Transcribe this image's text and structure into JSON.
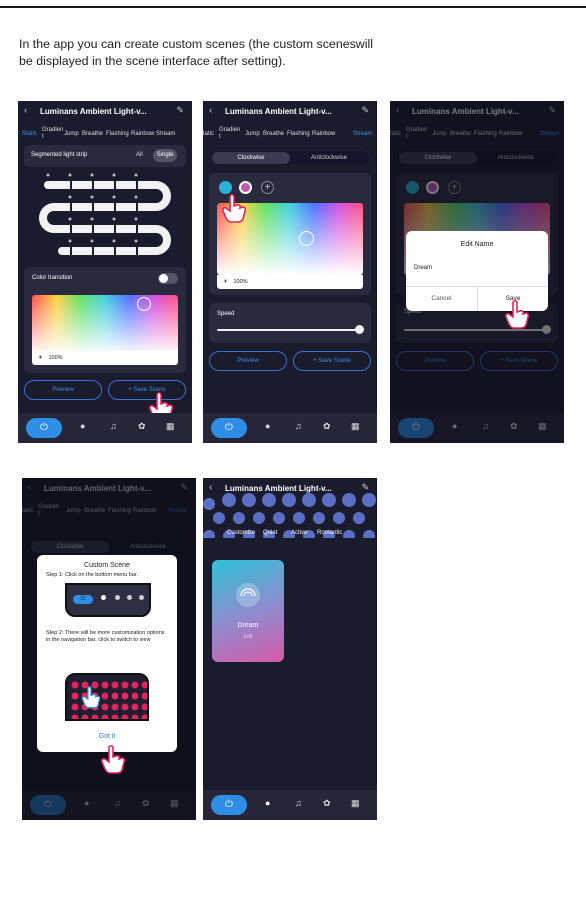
{
  "intro": {
    "line1": "In the app you can create custom scenes (the custom sceneswill",
    "line2": "be displayed in the scene interface after setting)."
  },
  "app": {
    "title": "Luminans Ambient Light-v...",
    "tabs": [
      "Static",
      "Gradien t",
      "Jump",
      "Breathe",
      "Flashing",
      "Rainbow",
      "Stream"
    ],
    "brightness": "100%",
    "preview": "Preview",
    "save_scene": "+ Save Scene",
    "accent": "#3a8fe0"
  },
  "screen1": {
    "segmented_label": "Segmented light strip",
    "opt_all": "All",
    "opt_single": "Single",
    "color_transition": "Color transition",
    "tab_active": "Static"
  },
  "screen2": {
    "clockwise": "Clockwise",
    "anticlockwise": "Anticlockwise",
    "speed": "Speed",
    "tab_active": "Stream"
  },
  "screen3": {
    "dialog_title": "Edit Name",
    "name_value": "Dream",
    "cancel": "Cancel",
    "save": "Save"
  },
  "screen4": {
    "dialog_title": "Custom Scene",
    "step1": "Step 1: Click on the bottom menu bar.",
    "step2": "Step 2: There will be more customization options in the navigation bar, click to switch to view",
    "got_it": "Got it"
  },
  "screen5": {
    "tabs": [
      "Customize",
      "Quiet",
      "Active",
      "Romantic"
    ],
    "scene_name": "Dream",
    "scene_sub": "Edit"
  }
}
